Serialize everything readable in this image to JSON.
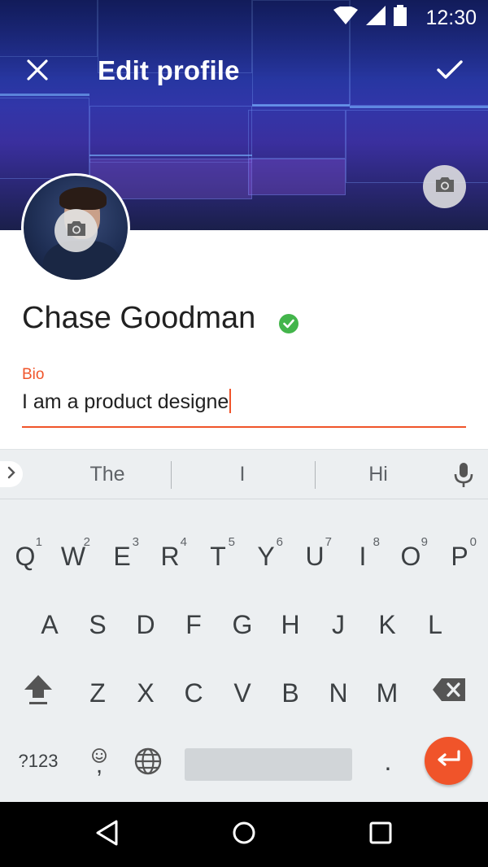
{
  "status_bar": {
    "time": "12:30"
  },
  "toolbar": {
    "title": "Edit profile"
  },
  "profile": {
    "name": "Chase Goodman"
  },
  "bio": {
    "label": "Bio",
    "value": "I am a product designe"
  },
  "keyboard": {
    "suggestions": [
      "The",
      "I",
      "Hi"
    ],
    "row1": [
      {
        "label": "Q",
        "hint": "1"
      },
      {
        "label": "W",
        "hint": "2"
      },
      {
        "label": "E",
        "hint": "3"
      },
      {
        "label": "R",
        "hint": "4"
      },
      {
        "label": "T",
        "hint": "5"
      },
      {
        "label": "Y",
        "hint": "6"
      },
      {
        "label": "U",
        "hint": "7"
      },
      {
        "label": "I",
        "hint": "8"
      },
      {
        "label": "O",
        "hint": "9"
      },
      {
        "label": "P",
        "hint": "0"
      }
    ],
    "row2": [
      "A",
      "S",
      "D",
      "F",
      "G",
      "H",
      "J",
      "K",
      "L"
    ],
    "row3": [
      "Z",
      "X",
      "C",
      "V",
      "B",
      "N",
      "M"
    ],
    "symbols_label": "?123",
    "comma_label": ",",
    "period_label": "."
  },
  "colors": {
    "accent": "#f0542a",
    "verified": "#43b54b"
  },
  "icons": [
    "wifi-icon",
    "signal-icon",
    "battery-icon",
    "close-icon",
    "check-icon",
    "camera-icon",
    "verified-icon",
    "chevron-right-icon",
    "mic-icon",
    "shift-icon",
    "backspace-icon",
    "emoji-icon",
    "globe-icon",
    "enter-icon",
    "back-icon",
    "home-icon",
    "recents-icon"
  ]
}
